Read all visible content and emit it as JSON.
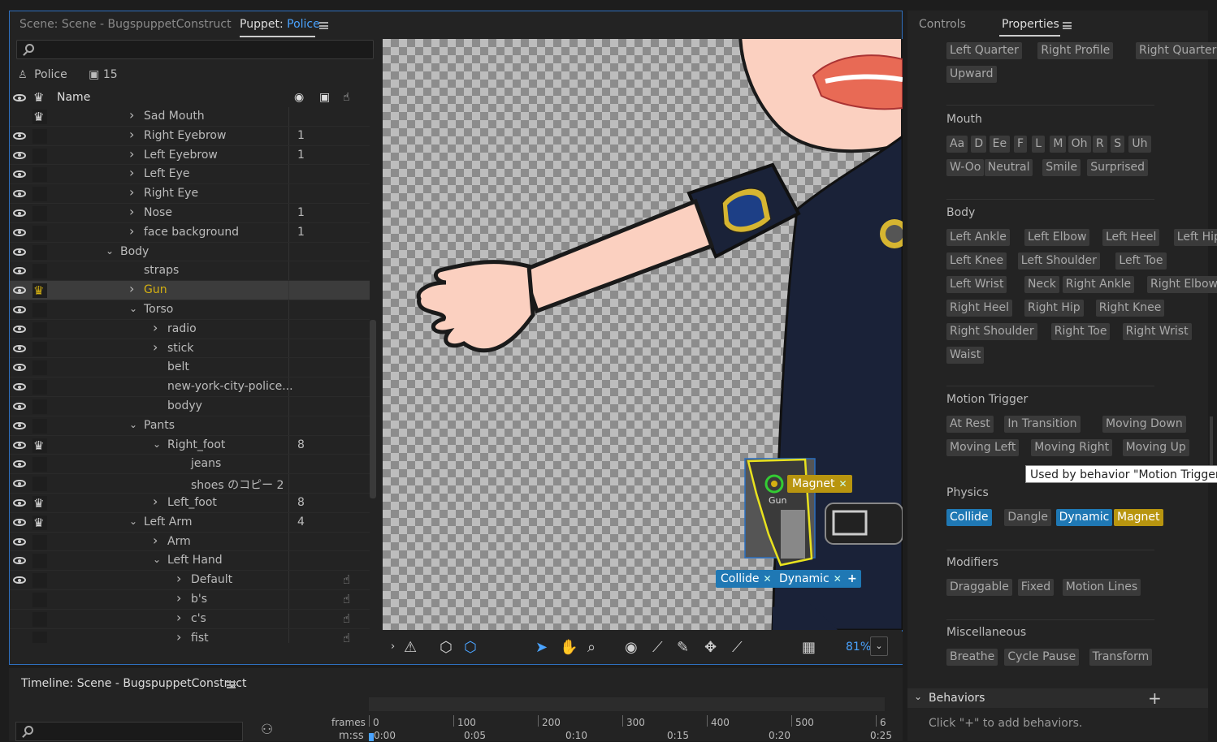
{
  "scene_tab": {
    "label": "Scene: Scene - BugspuppetConstruct"
  },
  "puppet_tab": {
    "prefix": "Puppet:",
    "name": "Police"
  },
  "puppet_info": {
    "name": "Police",
    "count": "15"
  },
  "layers_header": {
    "name_col": "Name"
  },
  "layers": [
    {
      "name": "Sad Mouth",
      "depth": 3,
      "chevron": "right",
      "num": "",
      "eye": false,
      "crown": "white",
      "hand": false
    },
    {
      "name": "Right Eyebrow",
      "depth": 3,
      "chevron": "right",
      "num": "1",
      "eye": true,
      "crown": "",
      "hand": false
    },
    {
      "name": "Left Eyebrow",
      "depth": 3,
      "chevron": "right",
      "num": "1",
      "eye": true,
      "crown": "",
      "hand": false
    },
    {
      "name": "Left Eye",
      "depth": 3,
      "chevron": "right",
      "num": "",
      "eye": true,
      "crown": "",
      "hand": false
    },
    {
      "name": "Right Eye",
      "depth": 3,
      "chevron": "right",
      "num": "",
      "eye": true,
      "crown": "",
      "hand": false
    },
    {
      "name": "Nose",
      "depth": 3,
      "chevron": "right",
      "num": "1",
      "eye": true,
      "crown": "",
      "hand": false
    },
    {
      "name": "face background",
      "depth": 3,
      "chevron": "right",
      "num": "1",
      "eye": true,
      "crown": "",
      "hand": false
    },
    {
      "name": "Body",
      "depth": 2,
      "chevron": "down",
      "num": "",
      "eye": true,
      "crown": "",
      "hand": false
    },
    {
      "name": "straps",
      "depth": 3,
      "chevron": "",
      "num": "",
      "eye": true,
      "crown": "",
      "hand": false
    },
    {
      "name": "Gun",
      "depth": 3,
      "chevron": "right",
      "num": "",
      "eye": true,
      "crown": "gold",
      "hand": false,
      "selected": true
    },
    {
      "name": "Torso",
      "depth": 3,
      "chevron": "down",
      "num": "",
      "eye": true,
      "crown": "",
      "hand": false
    },
    {
      "name": "radio",
      "depth": 4,
      "chevron": "right",
      "num": "",
      "eye": true,
      "crown": "",
      "hand": false
    },
    {
      "name": "stick",
      "depth": 4,
      "chevron": "right",
      "num": "",
      "eye": true,
      "crown": "",
      "hand": false
    },
    {
      "name": "belt",
      "depth": 4,
      "chevron": "",
      "num": "",
      "eye": true,
      "crown": "",
      "hand": false
    },
    {
      "name": "new-york-city-police...",
      "depth": 4,
      "chevron": "",
      "num": "",
      "eye": true,
      "crown": "",
      "hand": false
    },
    {
      "name": "bodyy",
      "depth": 4,
      "chevron": "",
      "num": "",
      "eye": true,
      "crown": "",
      "hand": false
    },
    {
      "name": "Pants",
      "depth": 3,
      "chevron": "down",
      "num": "",
      "eye": true,
      "crown": "",
      "hand": false
    },
    {
      "name": "Right_foot",
      "depth": 4,
      "chevron": "down",
      "num": "8",
      "eye": true,
      "crown": "white",
      "hand": false
    },
    {
      "name": "jeans",
      "depth": 5,
      "chevron": "",
      "num": "",
      "eye": true,
      "crown": "",
      "hand": false
    },
    {
      "name": "shoes のコピー 2",
      "depth": 5,
      "chevron": "",
      "num": "",
      "eye": true,
      "crown": "",
      "hand": false
    },
    {
      "name": "Left_foot",
      "depth": 4,
      "chevron": "right",
      "num": "8",
      "eye": true,
      "crown": "white",
      "hand": false
    },
    {
      "name": "Left Arm",
      "depth": 3,
      "chevron": "down",
      "num": "4",
      "eye": true,
      "crown": "white",
      "hand": false
    },
    {
      "name": "Arm",
      "depth": 4,
      "chevron": "right",
      "num": "",
      "eye": true,
      "crown": "",
      "hand": false
    },
    {
      "name": "Left Hand",
      "depth": 4,
      "chevron": "down",
      "num": "",
      "eye": true,
      "crown": "",
      "hand": false
    },
    {
      "name": "Default",
      "depth": 5,
      "chevron": "right",
      "num": "",
      "eye": true,
      "crown": "",
      "hand": true
    },
    {
      "name": "b's",
      "depth": 5,
      "chevron": "right",
      "num": "",
      "eye": false,
      "crown": "",
      "hand": true
    },
    {
      "name": "c's",
      "depth": 5,
      "chevron": "right",
      "num": "",
      "eye": false,
      "crown": "",
      "hand": true
    },
    {
      "name": "fist",
      "depth": 5,
      "chevron": "right",
      "num": "",
      "eye": false,
      "crown": "",
      "hand": true
    }
  ],
  "canvas_tags": {
    "magnet": "Magnet",
    "collide": "Collide",
    "dynamic": "Dynamic",
    "add": "+",
    "gun_label": "Gun"
  },
  "canvas_toolbar": {
    "zoom": "81%"
  },
  "props_tabs": {
    "controls": "Controls",
    "properties": "Properties"
  },
  "sections": {
    "head_turner": [
      "Left Quarter",
      "Right Profile",
      "Right Quarter",
      "Upward"
    ],
    "mouth": {
      "title": "Mouth",
      "items": [
        "Aa",
        "D",
        "Ee",
        "F",
        "L",
        "M",
        "Oh",
        "R",
        "S",
        "Uh",
        "W-Oo",
        "Neutral",
        "Smile",
        "Surprised"
      ]
    },
    "body": {
      "title": "Body",
      "items": [
        "Left Ankle",
        "Left Elbow",
        "Left Heel",
        "Left Hip",
        "Left Knee",
        "Left Shoulder",
        "Left Toe",
        "Left Wrist",
        "Neck",
        "Right Ankle",
        "Right Elbow",
        "Right Heel",
        "Right Hip",
        "Right Knee",
        "Right Shoulder",
        "Right Toe",
        "Right Wrist",
        "Waist"
      ]
    },
    "motion_trigger": {
      "title": "Motion Trigger",
      "items": [
        "At Rest",
        "In Transition",
        "Moving Down",
        "Moving Left",
        "Moving Right",
        "Moving Up"
      ]
    },
    "physics": {
      "title": "Physics",
      "items": [
        "Collide",
        "Dangle",
        "Dynamic",
        "Magnet"
      ]
    },
    "modifiers": {
      "title": "Modifiers",
      "items": [
        "Draggable",
        "Fixed",
        "Motion Lines"
      ]
    },
    "misc": {
      "title": "Miscellaneous",
      "items": [
        "Breathe",
        "Cycle Pause",
        "Transform"
      ]
    }
  },
  "tooltip": "Used by behavior \"Motion Trigger\"",
  "behaviors": {
    "title": "Behaviors",
    "hint": "Click \"+\" to add behaviors.",
    "add": "+"
  },
  "timeline": {
    "title": "Timeline: Scene - BugspuppetConstruct",
    "frames_label": "frames",
    "mss_label": "m:ss",
    "frame_ticks": [
      "0",
      "100",
      "200",
      "300",
      "400",
      "500",
      "6"
    ],
    "time_ticks": [
      "0:00",
      "0:05",
      "0:10",
      "0:15",
      "0:20",
      "0:25"
    ]
  },
  "colors": {
    "accent": "#4aa3ff",
    "tag_blue": "#1f78b4",
    "tag_yellow": "#b8950f",
    "selection_gold": "#d4b012"
  }
}
